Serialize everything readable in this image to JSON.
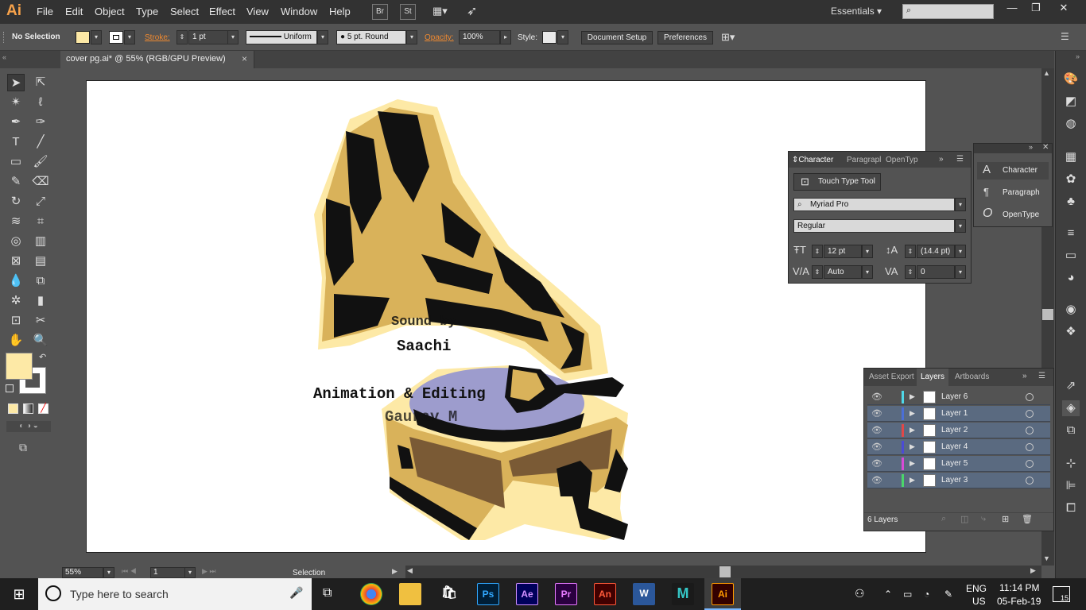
{
  "menubar": {
    "logo": "Ai",
    "items": [
      "File",
      "Edit",
      "Object",
      "Type",
      "Select",
      "Effect",
      "View",
      "Window",
      "Help"
    ],
    "bridge": "Br",
    "stock": "St",
    "workspace": "Essentials"
  },
  "controlbar": {
    "selection": "No Selection",
    "stroke_label": "Stroke:",
    "stroke_weight": "1 pt",
    "profile": "Uniform",
    "brush": "5 pt. Round",
    "opacity_label": "Opacity:",
    "opacity": "100%",
    "style_label": "Style:",
    "document_setup": "Document Setup",
    "preferences": "Preferences",
    "fill_color": "#fde9a6"
  },
  "document": {
    "tab_title": "cover pg.ai* @ 55% (RGB/GPU Preview)",
    "close": "×"
  },
  "artwork": {
    "line1": "Sound by",
    "line2": "Saachi",
    "line3": "Animation & Editing",
    "line4": "Gaurav M"
  },
  "statusbar": {
    "zoom": "55%",
    "artboard": "1",
    "tool": "Selection"
  },
  "character_panel": {
    "tabs": [
      "Character",
      "Paragrapl",
      "OpenTyp"
    ],
    "touch_type": "Touch Type Tool",
    "font": "Myriad Pro",
    "style": "Regular",
    "size": "12 pt",
    "leading": "(14.4 pt)",
    "kerning": "Auto",
    "tracking": "0"
  },
  "collapsed_panel": {
    "items": [
      "Character",
      "Paragraph",
      "OpenType"
    ]
  },
  "layers_panel": {
    "tabs": [
      "Asset Export",
      "Layers",
      "Artboards"
    ],
    "layers": [
      {
        "name": "Layer 6",
        "color": "#4fd8e8"
      },
      {
        "name": "Layer 1",
        "color": "#4b6fd6"
      },
      {
        "name": "Layer 2",
        "color": "#e04848"
      },
      {
        "name": "Layer 4",
        "color": "#4b4bd6"
      },
      {
        "name": "Layer 5",
        "color": "#d84bd6"
      },
      {
        "name": "Layer 3",
        "color": "#4bd66a"
      }
    ],
    "count": "6 Layers"
  },
  "taskbar": {
    "search_placeholder": "Type here to search",
    "apps": [
      "Ps",
      "Ae",
      "Pr",
      "An",
      "W",
      "M",
      "Ai"
    ],
    "lang": "ENG",
    "region": "US",
    "time": "11:14 PM",
    "date": "05-Feb-19",
    "notifications": "15"
  }
}
